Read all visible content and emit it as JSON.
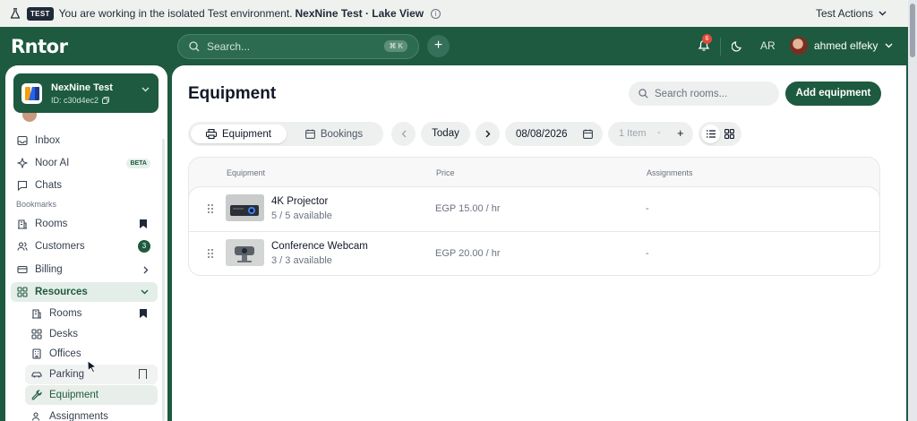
{
  "banner": {
    "badge": "TEST",
    "message": "You are working in the isolated Test environment.",
    "workspace": "NexNine Test · Lake View",
    "actions_label": "Test Actions"
  },
  "topnav": {
    "logo": "Rntor",
    "search_placeholder": "Search...",
    "shortcut": "⌘ K",
    "notification_count": "6",
    "language": "AR",
    "user_name": "ahmed elfeky"
  },
  "sidebar": {
    "workspace_name": "NexNine Test",
    "workspace_id": "ID: c30d4ec2",
    "items": [
      {
        "label": "Inbox"
      },
      {
        "label": "Noor AI",
        "badge": "BETA"
      },
      {
        "label": "Chats"
      }
    ],
    "bookmarks_title": "Bookmarks",
    "bookmarks": [
      {
        "label": "Rooms"
      },
      {
        "label": "Customers",
        "count": "3"
      },
      {
        "label": "Billing"
      },
      {
        "label": "Resources"
      }
    ],
    "resources": [
      {
        "label": "Rooms"
      },
      {
        "label": "Desks"
      },
      {
        "label": "Offices"
      },
      {
        "label": "Parking"
      },
      {
        "label": "Equipment"
      },
      {
        "label": "Assignments"
      }
    ]
  },
  "main": {
    "title": "Equipment",
    "search_placeholder": "Search rooms...",
    "add_button": "Add equipment",
    "tabs": [
      {
        "label": "Equipment"
      },
      {
        "label": "Bookings"
      }
    ],
    "today": "Today",
    "date": "08/08/2026",
    "quantity": "1 Item",
    "qty_minus": "-",
    "qty_plus": "+",
    "columns": [
      "Equipment",
      "Price",
      "Assignments"
    ],
    "rows": [
      {
        "name": "4K Projector",
        "availability": "5 / 5 available",
        "price": "EGP 15.00 / hr",
        "assignments": "-"
      },
      {
        "name": "Conference Webcam",
        "availability": "3 / 3 available",
        "price": "EGP 20.00 / hr",
        "assignments": "-"
      }
    ]
  },
  "colors": {
    "brand": "#1d5a3f",
    "banner_bg": "#eef1ee",
    "badge_red": "#e24a3b"
  }
}
